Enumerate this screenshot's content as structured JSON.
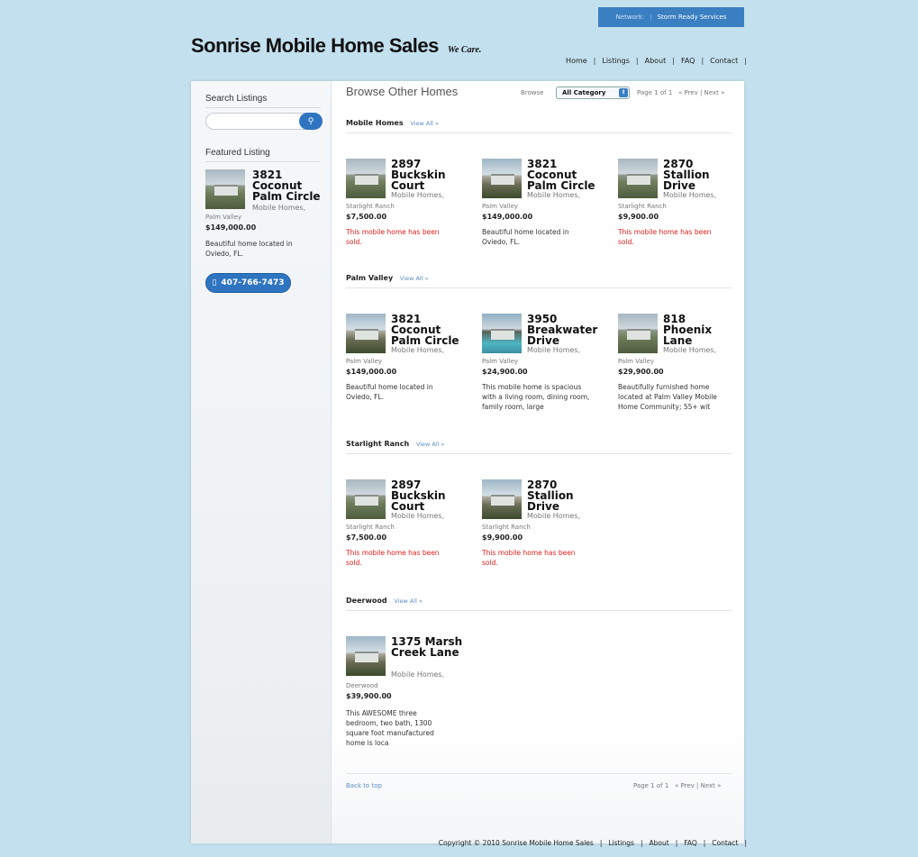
{
  "network": {
    "label": "Network:",
    "service": "Storm Ready Services"
  },
  "site": {
    "name": "Sonrise Mobile Home Sales",
    "tagline": "We Care."
  },
  "nav": [
    "Home",
    "Listings",
    "About",
    "FAQ",
    "Contact"
  ],
  "sidebar": {
    "search_heading": "Search Listings",
    "search_placeholder": "",
    "featured_heading": "Featured Listing",
    "featured": {
      "title": "3821 Coconut Palm Circle",
      "category": "Mobile Homes,",
      "location": "Palm Valley",
      "price": "$149,000.00",
      "description": "Beautiful home located in Oviedo, FL."
    },
    "phone": "407-766-7473"
  },
  "main": {
    "title": "Browse Other Homes",
    "browse_label": "Browse",
    "category_select": "All Category",
    "page_info": "Page 1 of 1",
    "pager_links": "« Prev | Next »",
    "view_all": "View All »",
    "back_to_top": "Back to top",
    "sections": [
      {
        "name": "Mobile Homes",
        "listings": [
          {
            "title": "2897 Buckskin Court",
            "category": "Mobile Homes,",
            "location": "Starlight Ranch",
            "price": "$7,500.00",
            "note": "This mobile home has been sold."
          },
          {
            "title": "3821 Coconut Palm Circle",
            "category": "Mobile Homes,",
            "location": "Palm Valley",
            "price": "$149,000.00",
            "note": "Beautiful home located in Oviedo, FL."
          },
          {
            "title": "2870 Stallion Drive",
            "category": "Mobile Homes,",
            "location": "Starlight Ranch",
            "price": "$9,900.00",
            "note": "This mobile home has been sold."
          }
        ]
      },
      {
        "name": "Palm Valley",
        "listings": [
          {
            "title": "3821 Coconut Palm Circle",
            "category": "Mobile Homes,",
            "location": "Palm Valley",
            "price": "$149,000.00",
            "note": "Beautiful home located in Oviedo, FL."
          },
          {
            "title": "3950 Breakwater Drive",
            "category": "Mobile Homes,",
            "location": "Palm Valley",
            "price": "$24,900.00",
            "note": "This mobile home is spacious with a living room, dining room, family room, large"
          },
          {
            "title": "818 Phoenix Lane",
            "category": "Mobile Homes,",
            "location": "Palm Valley",
            "price": "$29,900.00",
            "note": "Beautifully furnished home located at Palm Valley Mobile Home Community; 55+ wit"
          }
        ]
      },
      {
        "name": "Starlight Ranch",
        "listings": [
          {
            "title": "2897 Buckskin Court",
            "category": "Mobile Homes,",
            "location": "Starlight Ranch",
            "price": "$7,500.00",
            "note": "This mobile home has been sold."
          },
          {
            "title": "2870 Stallion Drive",
            "category": "Mobile Homes,",
            "location": "Starlight Ranch",
            "price": "$9,900.00",
            "note": "This mobile home has been sold."
          }
        ]
      },
      {
        "name": "Deerwood",
        "listings": [
          {
            "title": "1375 Marsh Creek Lane",
            "category": "Mobile Homes,",
            "location": "Deerwood",
            "price": "$39,900.00",
            "note": "This AWESOME three bedroom, two bath, 1300 square foot manufactured home is loca"
          }
        ]
      }
    ]
  },
  "footer": {
    "copyright": "Copyright © 2010 Sonrise Mobile Home Sales",
    "links": [
      "Listings",
      "About",
      "FAQ",
      "Contact"
    ]
  }
}
